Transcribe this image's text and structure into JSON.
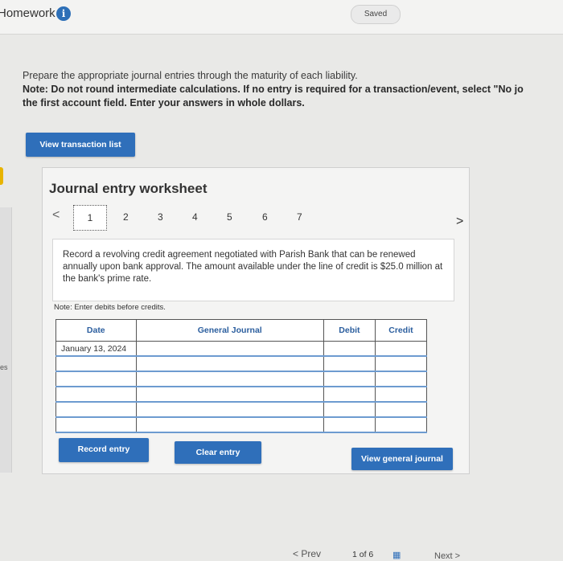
{
  "header": {
    "title": "Homework",
    "info_icon": "info-icon",
    "status": "Saved"
  },
  "instructions": {
    "line1": "Prepare the appropriate journal entries through the maturity of each liability.",
    "note": "Note: Do not round intermediate calculations. If no entry is required for a transaction/event, select \"No jo",
    "note2": "the first account field. Enter your answers in whole dollars."
  },
  "buttons": {
    "view_transactions": "View transaction list",
    "record_entry": "Record entry",
    "clear_entry": "Clear entry",
    "view_general_journal": "View general journal"
  },
  "left_edge": {
    "text": "es"
  },
  "worksheet": {
    "title": "Journal entry worksheet",
    "tabs": [
      "1",
      "2",
      "3",
      "4",
      "5",
      "6",
      "7"
    ],
    "active_tab": "1",
    "description": "Record a revolving credit agreement negotiated with Parish Bank that can be renewed annually upon bank approval. The amount available under the line of credit is $25.0 million at the bank's prime rate.",
    "note": "Note: Enter debits before credits.",
    "table": {
      "headers": [
        "Date",
        "General Journal",
        "Debit",
        "Credit"
      ],
      "first_date": "January 13, 2024"
    }
  },
  "bottom_nav": {
    "prev": "Prev",
    "page": "1 of 6",
    "next": "Next"
  }
}
